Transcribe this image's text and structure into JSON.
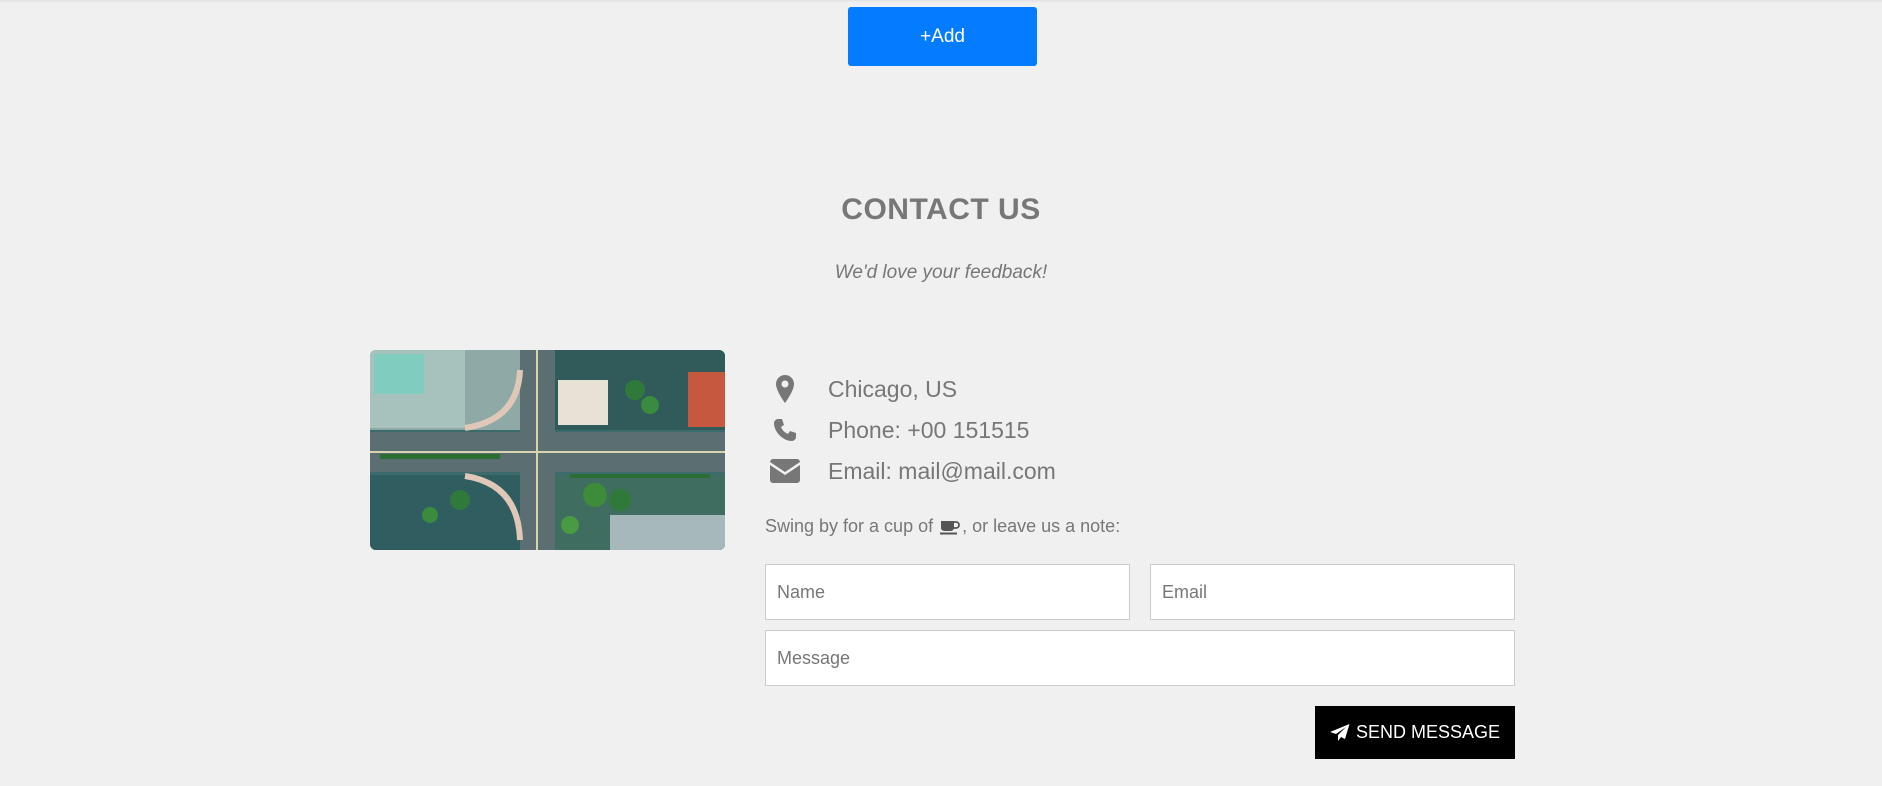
{
  "toolbar": {
    "add_label": "+Add"
  },
  "contact": {
    "title": "CONTACT US",
    "subtitle": "We'd love your feedback!",
    "location": "Chicago, US",
    "phone": "Phone: +00 151515",
    "email": "Email: mail@mail.com",
    "note_before": "Swing by for a cup of ",
    "note_after": ", or leave us a note:",
    "icons": [
      "map-marker-icon",
      "phone-icon",
      "envelope-icon",
      "coffee-icon",
      "paper-plane-icon"
    ]
  },
  "form": {
    "name_placeholder": "Name",
    "email_placeholder": "Email",
    "message_placeholder": "Message",
    "send_label": "SEND MESSAGE"
  },
  "colors": {
    "background": "#f0f0f0",
    "accent": "#057cff",
    "text": "#777777",
    "send_button": "#000000"
  }
}
